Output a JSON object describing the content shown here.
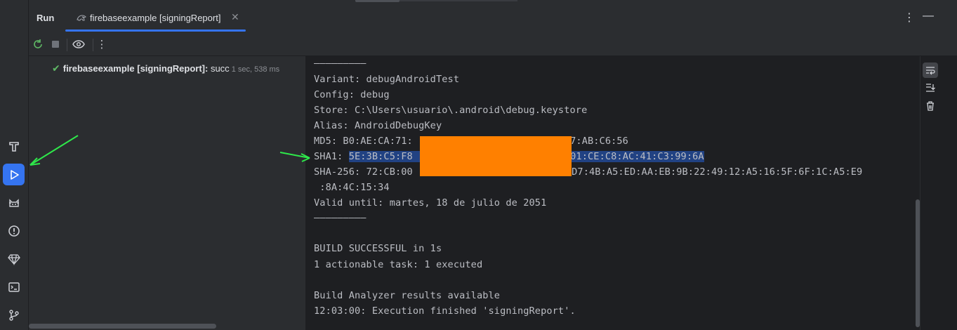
{
  "tool_window": {
    "title": "Run",
    "tab_label": "firebaseexample [signingReport]",
    "more_icon": "⋮",
    "minimize_icon": "—"
  },
  "toolbar": {
    "rerun_icon": "rerun-icon",
    "stop_icon": "stop-icon",
    "view_icon": "eye-icon",
    "more_icon": "⋮"
  },
  "tree": {
    "item_label": "firebaseexample [signingReport]:",
    "item_status": " succ",
    "item_time": "1 sec, 538 ms"
  },
  "console": {
    "lines": [
      "—————————",
      "Variant: debugAndroidTest",
      "Config: debug",
      "Store: C:\\Users\\usuario\\.android\\debug.keystore",
      "Alias: AndroidDebugKey",
      "SHA-256: 72:CB:00",
      " :8A:4C:15:34",
      "Valid until: martes, 18 de julio de 2051",
      "—————————",
      "BUILD SUCCESSFUL in 1s",
      "1 actionable task: 1 executed",
      "Build Analyzer results available",
      "12:03:00: Execution finished 'signingReport'."
    ],
    "md5_prefix": "MD5: B0:AE:CA:71:",
    "md5_suffix": "F7:AB:C6:56",
    "sha1_label": "SHA1: ",
    "sha1_sel_a": "5E:3B:C5:F8",
    "sha1_sel_b": ":01:CE:C8:AC:41:C3:99:6A",
    "sha256_suffix": ":D7:4B:A5:ED:AA:EB:9B:22:49:12:A5:16:5F:6F:1C:A5:E9"
  },
  "colors": {
    "accent": "#3574f0",
    "success": "#5fb865",
    "redaction": "#ff8000",
    "selection": "#214283",
    "annotation_arrow": "#2ee84a"
  },
  "activity_bar": [
    "build-icon",
    "run-icon",
    "logcat-icon",
    "problems-icon",
    "gem-icon",
    "terminal-icon",
    "git-icon"
  ]
}
